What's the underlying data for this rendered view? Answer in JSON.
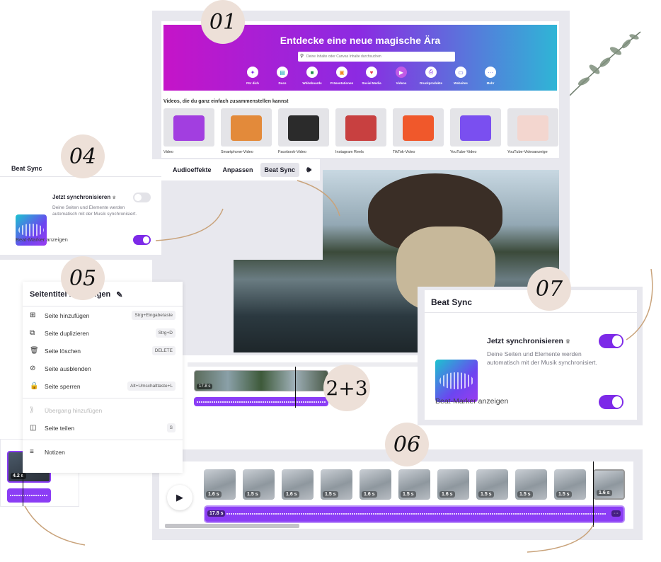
{
  "badges": {
    "b01": "01",
    "b04": "04",
    "b05": "05",
    "b07": "07",
    "b23": "2+3",
    "b06": "06"
  },
  "home": {
    "title": "Entdecke eine neue magische Ära",
    "search_placeholder": "Deine Inhalte oder Canvas Inhalte durchsuchen",
    "categories": [
      {
        "label": "Für dich",
        "icon": "sparkle-icon",
        "color": "#7d2ae8"
      },
      {
        "label": "Docs",
        "icon": "doc-icon",
        "color": "#13a3b5"
      },
      {
        "label": "Whiteboards",
        "icon": "whiteboard-icon",
        "color": "#1e8a4c"
      },
      {
        "label": "Präsentationen",
        "icon": "presentation-icon",
        "color": "#f08a24"
      },
      {
        "label": "Social Media",
        "icon": "heart-icon",
        "color": "#e8384f"
      },
      {
        "label": "Videos",
        "icon": "video-icon",
        "color": "#ffffff"
      },
      {
        "label": "Druckprodukte",
        "icon": "print-icon",
        "color": "#7d2ae8"
      },
      {
        "label": "Websites",
        "icon": "website-icon",
        "color": "#4b4fe0"
      },
      {
        "label": "Mehr",
        "icon": "more-icon",
        "color": "#5b6be8"
      }
    ],
    "section_title": "Videos, die du ganz einfach zusammenstellen kannst",
    "templates": [
      "Video",
      "Smartphone-Video",
      "Facebook-Video",
      "Instagram Reels",
      "TikTok-Video",
      "YouTube-Video",
      "YouTube-Videoanzeige"
    ]
  },
  "beat_small": {
    "header": "Beat Sync",
    "tabs": [
      "Audioeffekte",
      "Anpassen",
      "Beat Sync"
    ],
    "sync_title": "Jetzt synchronisieren",
    "sync_desc": "Deine Seiten und Elemente werden automatisch mit der Musik synchronisiert.",
    "sync_on": false,
    "marker_label": "Beat-Marker anzeigen",
    "marker_on": true
  },
  "menu": {
    "title": "Seitentitel hinzufügen",
    "items": [
      {
        "label": "Seite hinzufügen",
        "shortcut": "Strg+Eingabetaste",
        "icon": "add-page-icon"
      },
      {
        "label": "Seite duplizieren",
        "shortcut": "Strg+D",
        "icon": "duplicate-icon"
      },
      {
        "label": "Seite löschen",
        "shortcut": "DELETE",
        "icon": "trash-icon"
      },
      {
        "label": "Seite ausblenden",
        "shortcut": "",
        "icon": "eye-off-icon"
      },
      {
        "label": "Seite sperren",
        "shortcut": "Alt+Umschalttaste+L",
        "icon": "lock-icon"
      },
      {
        "label": "Übergang hinzufügen",
        "shortcut": "",
        "icon": "transition-icon",
        "disabled": true
      },
      {
        "label": "Seite teilen",
        "shortcut": "S",
        "icon": "split-icon"
      },
      {
        "label": "Notizen",
        "shortcut": "",
        "icon": "notes-icon"
      }
    ]
  },
  "timeline23": {
    "clip_duration": "17.8 s"
  },
  "beat_large": {
    "header": "Beat Sync",
    "sync_title": "Jetzt synchronisieren",
    "sync_desc": "Deine Seiten und Elemente werden automatisch mit der Musik synchronisiert.",
    "sync_on": true,
    "marker_label": "Beat-Marker anzeigen",
    "marker_on": true
  },
  "timeline06": {
    "clips": [
      "1.6 s",
      "1.5 s",
      "1.6 s",
      "1.5 s",
      "1.6 s",
      "1.5 s",
      "1.6 s",
      "1.5 s",
      "1.5 s",
      "1.5 s",
      "1.6 s"
    ],
    "audio_duration": "17.8 s",
    "more": "···"
  },
  "left_timeline": {
    "clip_duration": "4.2 s"
  },
  "colors": {
    "accent": "#7d2ae8",
    "badge": "#ede0d8",
    "audio": "#8b3df5"
  }
}
